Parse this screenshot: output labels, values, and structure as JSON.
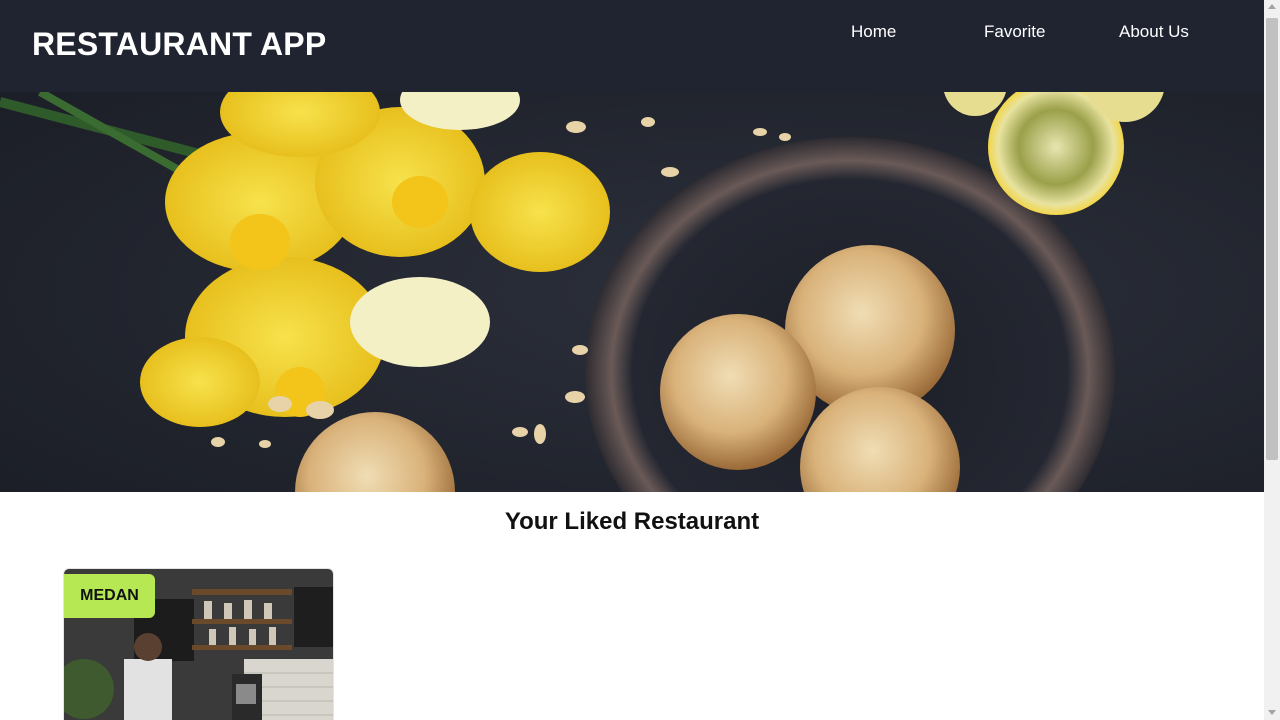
{
  "app": {
    "title": "RESTAURANT APP"
  },
  "nav": {
    "items": [
      {
        "label": "Home"
      },
      {
        "label": "Favorite"
      },
      {
        "label": "About Us"
      }
    ]
  },
  "hero": {
    "image_icon": "hero-food-photo"
  },
  "main": {
    "section_title": "Your Liked Restaurant",
    "restaurants": [
      {
        "city": "MEDAN",
        "image_icon": "restaurant-photo"
      }
    ]
  },
  "colors": {
    "header_bg": "#1f2430",
    "badge_bg": "#b5e853",
    "header_text": "#ffffff"
  }
}
